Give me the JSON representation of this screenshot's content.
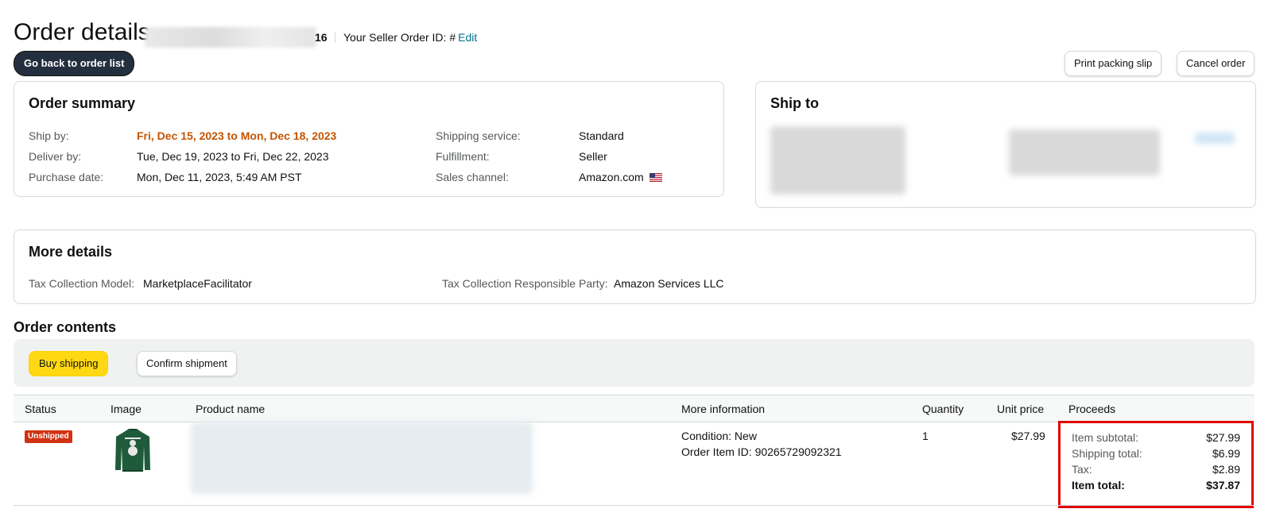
{
  "header": {
    "title": "Order details",
    "order_id_tail": "16",
    "seller_order_label": "Your Seller Order ID: #",
    "edit_label": "Edit",
    "back_button": "Go back to order list",
    "print_button": "Print packing slip",
    "cancel_button": "Cancel order"
  },
  "summary": {
    "title": "Order summary",
    "ship_by_label": "Ship by:",
    "ship_by_value": "Fri, Dec 15, 2023 to Mon, Dec 18, 2023",
    "deliver_by_label": "Deliver by:",
    "deliver_by_value": "Tue, Dec 19, 2023 to Fri, Dec 22, 2023",
    "purchase_date_label": "Purchase date:",
    "purchase_date_value": "Mon, Dec 11, 2023, 5:49 AM PST",
    "shipping_service_label": "Shipping service:",
    "shipping_service_value": "Standard",
    "fulfillment_label": "Fulfillment:",
    "fulfillment_value": "Seller",
    "sales_channel_label": "Sales channel:",
    "sales_channel_value": "Amazon.com"
  },
  "ship_to": {
    "title": "Ship to"
  },
  "more_details": {
    "title": "More details",
    "tax_model_label": "Tax Collection Model:",
    "tax_model_value": "MarketplaceFacilitator",
    "tax_party_label": "Tax Collection Responsible Party:",
    "tax_party_value": "Amazon Services LLC"
  },
  "contents": {
    "title": "Order contents",
    "buy_shipping": "Buy shipping",
    "confirm_shipment": "Confirm shipment",
    "columns": [
      "Status",
      "Image",
      "Product name",
      "More information",
      "Quantity",
      "Unit price",
      "Proceeds"
    ],
    "row": {
      "status": "Unshipped",
      "condition": "Condition: New",
      "order_item_id": "Order Item ID: 90265729092321",
      "quantity": "1",
      "unit_price": "$27.99",
      "proceeds": [
        {
          "label": "Item subtotal:",
          "value": "$27.99"
        },
        {
          "label": "Shipping total:",
          "value": "$6.99"
        },
        {
          "label": "Tax:",
          "value": "$2.89"
        },
        {
          "label": "Item total:",
          "value": "$37.87"
        }
      ]
    }
  },
  "colors": {
    "accent_link": "#007185",
    "ship_by_orange": "#c45500",
    "badge_red": "#d13212",
    "buy_shipping_yellow": "#ffd814",
    "highlight_box": "#e00000"
  }
}
